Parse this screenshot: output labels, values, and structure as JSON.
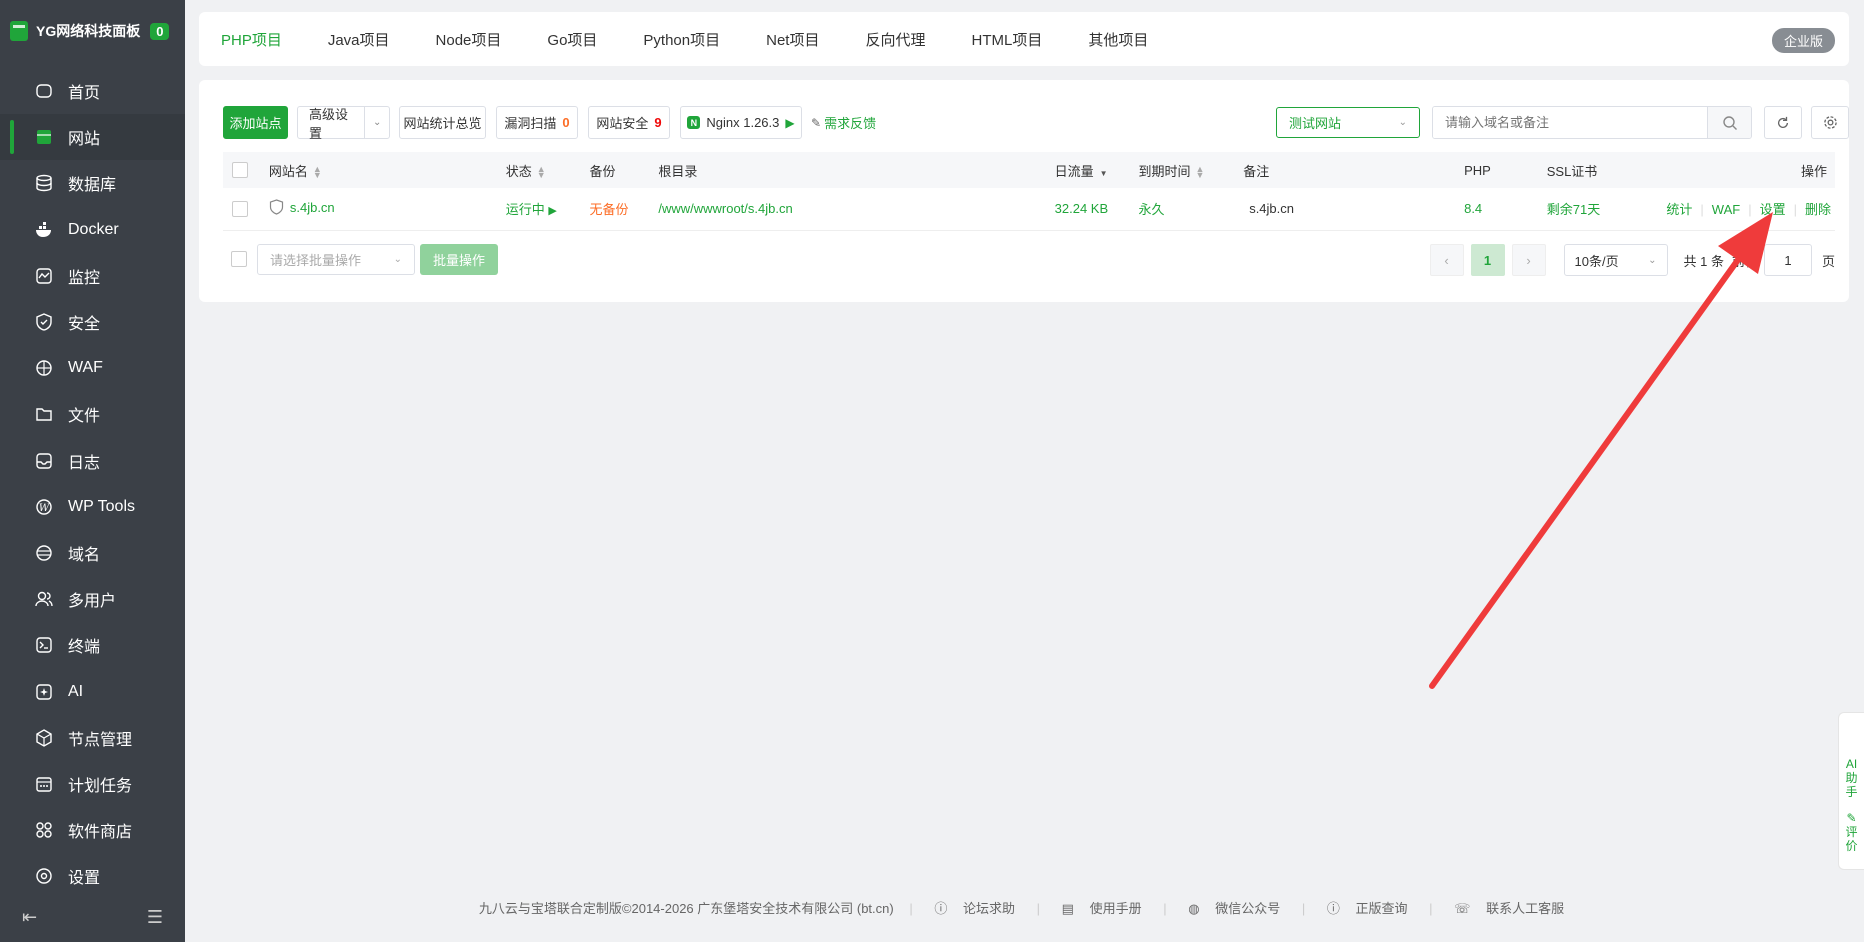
{
  "brand": {
    "title": "YG网络科技面板",
    "badge": "0"
  },
  "sidebar": {
    "items": [
      {
        "label": "首页",
        "icon": "home-icon"
      },
      {
        "label": "网站",
        "icon": "website-icon"
      },
      {
        "label": "数据库",
        "icon": "database-icon"
      },
      {
        "label": "Docker",
        "icon": "docker-icon"
      },
      {
        "label": "监控",
        "icon": "monitor-icon"
      },
      {
        "label": "安全",
        "icon": "shield-icon"
      },
      {
        "label": "WAF",
        "icon": "waf-icon"
      },
      {
        "label": "文件",
        "icon": "folder-icon"
      },
      {
        "label": "日志",
        "icon": "log-icon"
      },
      {
        "label": "WP Tools",
        "icon": "wordpress-icon"
      },
      {
        "label": "域名",
        "icon": "globe-icon"
      },
      {
        "label": "多用户",
        "icon": "users-icon"
      },
      {
        "label": "终端",
        "icon": "terminal-icon"
      },
      {
        "label": "AI",
        "icon": "ai-icon"
      },
      {
        "label": "节点管理",
        "icon": "node-icon"
      },
      {
        "label": "计划任务",
        "icon": "calendar-icon"
      },
      {
        "label": "软件商店",
        "icon": "store-icon"
      },
      {
        "label": "设置",
        "icon": "settings-icon"
      }
    ]
  },
  "tabs": [
    {
      "label": "PHP项目"
    },
    {
      "label": "Java项目"
    },
    {
      "label": "Node项目"
    },
    {
      "label": "Go项目"
    },
    {
      "label": "Python项目"
    },
    {
      "label": "Net项目"
    },
    {
      "label": "反向代理"
    },
    {
      "label": "HTML项目"
    },
    {
      "label": "其他项目"
    }
  ],
  "enterprise_badge": "企业版",
  "toolbar": {
    "add_site": "添加站点",
    "advanced": "高级设置",
    "stats_overview": "网站统计总览",
    "vuln_scan": "漏洞扫描",
    "vuln_count": "0",
    "site_security": "网站安全",
    "security_count": "9",
    "nginx": "Nginx 1.26.3",
    "feedback": "需求反馈",
    "category": "测试网站",
    "search_placeholder": "请输入域名或备注"
  },
  "table": {
    "headers": {
      "name": "网站名",
      "status": "状态",
      "backup": "备份",
      "root": "根目录",
      "traffic": "日流量",
      "expire": "到期时间",
      "note": "备注",
      "php": "PHP",
      "ssl": "SSL证书",
      "ops": "操作"
    },
    "rows": [
      {
        "name": "s.4jb.cn",
        "status": "运行中",
        "backup": "无备份",
        "root": "/www/wwwroot/s.4jb.cn",
        "traffic": "32.24 KB",
        "expire": "永久",
        "note": "s.4jb.cn",
        "php": "8.4",
        "ssl": "剩余71天",
        "op_stats": "统计",
        "op_waf": "WAF",
        "op_settings": "设置",
        "op_delete": "删除"
      }
    ]
  },
  "batch": {
    "placeholder": "请选择批量操作",
    "button": "批量操作"
  },
  "pager": {
    "current": "1",
    "per_page": "10条/页",
    "total": "共 1 条",
    "goto_prefix": "前往",
    "goto_value": "1",
    "goto_suffix": "页"
  },
  "footer": {
    "copyright": "九八云与宝塔联合定制版©2014-2026 广东堡塔安全技术有限公司 (bt.cn)",
    "links": [
      "论坛求助",
      "使用手册",
      "微信公众号",
      "正版查询",
      "联系人工客服"
    ]
  },
  "ai_widget": {
    "line1": "AI",
    "line2": "助",
    "line3": "手",
    "line4": "评",
    "line5": "价"
  },
  "colors": {
    "accent": "#20a53a",
    "sidebar": "#3b4047",
    "arrow": "#ef3b3b"
  }
}
